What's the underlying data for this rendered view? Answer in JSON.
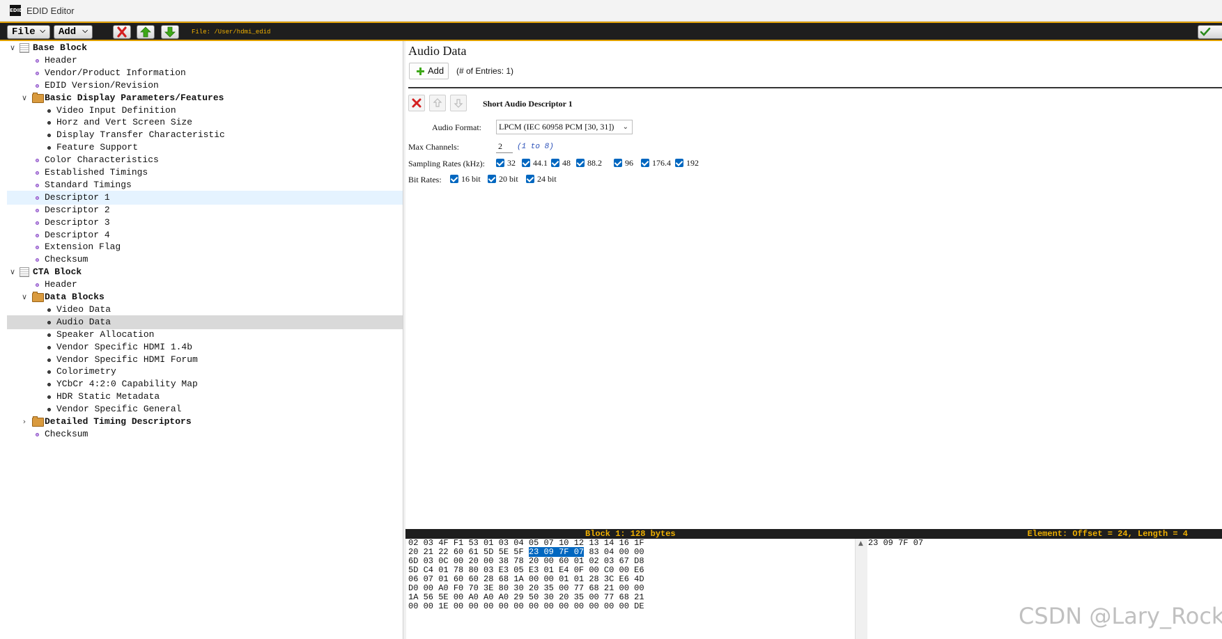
{
  "window": {
    "title": "EDID Editor",
    "icon_text": "EDID"
  },
  "toolbar": {
    "file_label": "File",
    "add_label": "Add",
    "file_path": "File: /User/hdmi_edid",
    "icons": [
      "delete-icon",
      "move-up-icon",
      "move-down-icon",
      "apply-check-icon"
    ]
  },
  "tree": {
    "items": [
      {
        "label": "Base Block",
        "level": 0,
        "kind": "block",
        "toggle": "expanded",
        "bold": true
      },
      {
        "label": "Header",
        "level": 1,
        "kind": "leaf"
      },
      {
        "label": "Vendor/Product Information",
        "level": 1,
        "kind": "leaf"
      },
      {
        "label": "EDID Version/Revision",
        "level": 1,
        "kind": "leaf"
      },
      {
        "label": "Basic Display Parameters/Features",
        "level": 1,
        "kind": "folder",
        "toggle": "expanded",
        "bold": true
      },
      {
        "label": "Video Input Definition",
        "level": 2,
        "kind": "item"
      },
      {
        "label": "Horz and Vert Screen Size",
        "level": 2,
        "kind": "item"
      },
      {
        "label": "Display Transfer Characteristic",
        "level": 2,
        "kind": "item"
      },
      {
        "label": "Feature Support",
        "level": 2,
        "kind": "item"
      },
      {
        "label": "Color Characteristics",
        "level": 1,
        "kind": "leaf"
      },
      {
        "label": "Established Timings",
        "level": 1,
        "kind": "leaf"
      },
      {
        "label": "Standard Timings",
        "level": 1,
        "kind": "leaf"
      },
      {
        "label": "Descriptor 1",
        "level": 1,
        "kind": "leaf",
        "state": "hover"
      },
      {
        "label": "Descriptor 2",
        "level": 1,
        "kind": "leaf"
      },
      {
        "label": "Descriptor 3",
        "level": 1,
        "kind": "leaf"
      },
      {
        "label": "Descriptor 4",
        "level": 1,
        "kind": "leaf"
      },
      {
        "label": "Extension Flag",
        "level": 1,
        "kind": "leaf"
      },
      {
        "label": "Checksum",
        "level": 1,
        "kind": "leaf"
      },
      {
        "label": "CTA Block",
        "level": 0,
        "kind": "block",
        "toggle": "expanded",
        "bold": true
      },
      {
        "label": "Header",
        "level": 1,
        "kind": "leaf"
      },
      {
        "label": "Data Blocks",
        "level": 1,
        "kind": "folder",
        "toggle": "expanded",
        "bold": true
      },
      {
        "label": "Video Data",
        "level": 2,
        "kind": "item"
      },
      {
        "label": "Audio Data",
        "level": 2,
        "kind": "item",
        "state": "selected"
      },
      {
        "label": "Speaker Allocation",
        "level": 2,
        "kind": "item"
      },
      {
        "label": "Vendor Specific HDMI 1.4b",
        "level": 2,
        "kind": "item"
      },
      {
        "label": "Vendor Specific HDMI Forum",
        "level": 2,
        "kind": "item"
      },
      {
        "label": "Colorimetry",
        "level": 2,
        "kind": "item"
      },
      {
        "label": "YCbCr 4:2:0 Capability Map",
        "level": 2,
        "kind": "item"
      },
      {
        "label": "HDR Static Metadata",
        "level": 2,
        "kind": "item"
      },
      {
        "label": "Vendor Specific General",
        "level": 2,
        "kind": "item"
      },
      {
        "label": "Detailed Timing Descriptors",
        "level": 1,
        "kind": "folder",
        "toggle": "collapsed",
        "bold": true
      },
      {
        "label": "Checksum",
        "level": 1,
        "kind": "leaf"
      }
    ]
  },
  "panel": {
    "title": "Audio Data",
    "add_label": "Add",
    "entries_text": "(# of Entries: 1)",
    "descriptor_title": "Short Audio Descriptor 1",
    "audio_format_label": "Audio Format:",
    "audio_format_value": "LPCM (IEC 60958 PCM [30, 31])",
    "max_channels_label": "Max Channels:",
    "max_channels_value": "2",
    "max_channels_range": "(1 to 8)",
    "sampling_rates_label": "Sampling Rates (kHz):",
    "sampling_rates": [
      "32",
      "44.1",
      "48",
      "88.2",
      "96",
      "176.4",
      "192"
    ],
    "bit_rates_label": "Bit Rates:",
    "bit_rates": [
      "16 bit",
      "20 bit",
      "24 bit"
    ]
  },
  "hex": {
    "block_title": "Block 1: 128 bytes",
    "element_info": "Element: Offset = 24, Length = 4",
    "rows": [
      "02 03 4F F1 53 01 03 04 05 07 10 12 13 14 16 1F",
      "20 21 22 60 61 5D 5E 5F 23 09 7F 07 83 04 00 00",
      "6D 03 0C 00 20 00 38 78 20 00 60 01 02 03 67 D8",
      "5D C4 01 78 80 03 E3 05 E3 01 E4 0F 00 C0 00 E6",
      "06 07 01 60 60 28 68 1A 00 00 01 01 28 3C E6 4D",
      "D0 00 A0 F0 70 3E 80 30 20 35 00 77 68 21 00 00",
      "1A 56 5E 00 A0 A0 A0 29 50 30 20 35 00 77 68 21",
      "00 00 1E 00 00 00 00 00 00 00 00 00 00 00 00 DE"
    ],
    "highlight": {
      "row": 1,
      "start": 8,
      "length": 4
    },
    "selected_bytes": "23 09 7F 07"
  },
  "watermark": "CSDN @Lary_Rock",
  "colors": {
    "toolbar_bg": "#1e1e1e",
    "accent": "#f0b000",
    "selection": "#0067c0",
    "tree_selected": "#d9d9d9",
    "tree_hover": "#e5f3ff"
  }
}
